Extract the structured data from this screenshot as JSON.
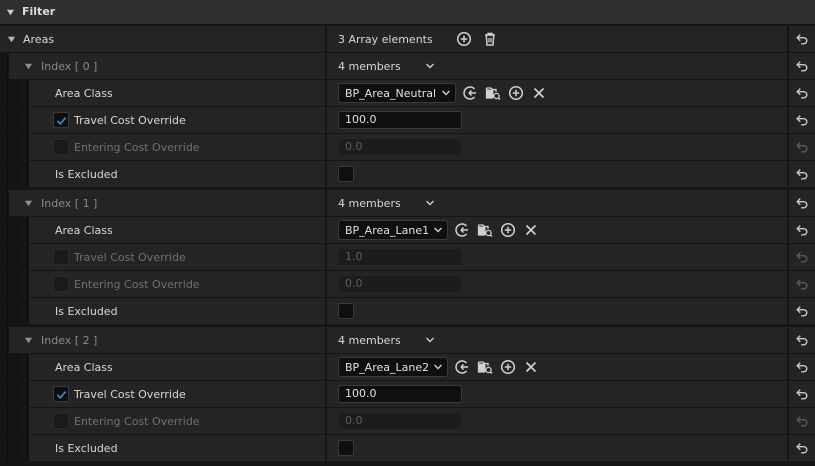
{
  "section": {
    "title": "Filter"
  },
  "areas": {
    "label": "Areas",
    "count_label": "3 Array elements"
  },
  "elements": [
    {
      "index_label": "Index [ 0 ]",
      "members_label": "4 members",
      "area_class": {
        "label": "Area Class",
        "value": "BP_Area_Neutral"
      },
      "travel_cost": {
        "label": "Travel Cost Override",
        "checked": true,
        "value": "100.0"
      },
      "entering_cost": {
        "label": "Entering Cost Override",
        "checked": false,
        "value": "0.0"
      },
      "is_excluded": {
        "label": "Is Excluded",
        "checked": false
      }
    },
    {
      "index_label": "Index [ 1 ]",
      "members_label": "4 members",
      "area_class": {
        "label": "Area Class",
        "value": "BP_Area_Lane1"
      },
      "travel_cost": {
        "label": "Travel Cost Override",
        "checked": false,
        "value": "1.0"
      },
      "entering_cost": {
        "label": "Entering Cost Override",
        "checked": false,
        "value": "0.0"
      },
      "is_excluded": {
        "label": "Is Excluded",
        "checked": false
      }
    },
    {
      "index_label": "Index [ 2 ]",
      "members_label": "4 members",
      "area_class": {
        "label": "Area Class",
        "value": "BP_Area_Lane2"
      },
      "travel_cost": {
        "label": "Travel Cost Override",
        "checked": true,
        "value": "100.0"
      },
      "entering_cost": {
        "label": "Entering Cost Override",
        "checked": false,
        "value": "0.0"
      },
      "is_excluded": {
        "label": "Is Excluded",
        "checked": false
      }
    }
  ],
  "colors": {
    "accent_check": "#2f8de4",
    "panel_bg": "#242424",
    "header_bg": "#2f2f2f"
  }
}
